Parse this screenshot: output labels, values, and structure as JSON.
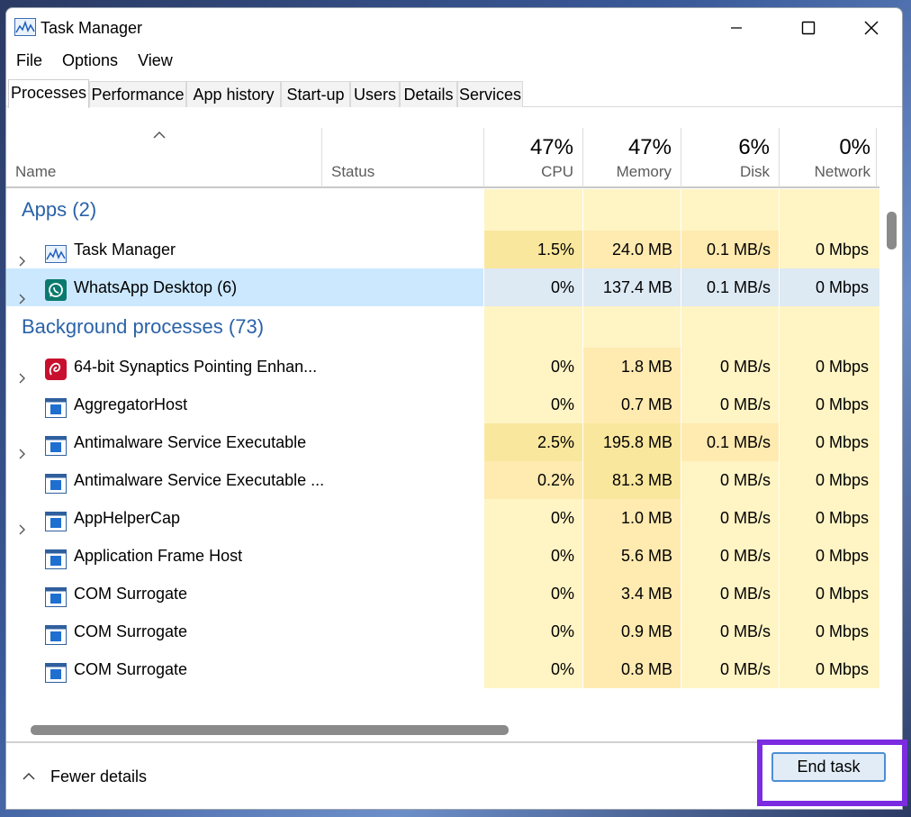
{
  "window": {
    "title": "Task Manager"
  },
  "menu": [
    "File",
    "Options",
    "View"
  ],
  "tabs": [
    "Processes",
    "Performance",
    "App history",
    "Start-up",
    "Users",
    "Details",
    "Services"
  ],
  "columns": {
    "name": "Name",
    "status": "Status",
    "cpu": {
      "pct": "47%",
      "label": "CPU"
    },
    "memory": {
      "pct": "47%",
      "label": "Memory"
    },
    "disk": {
      "pct": "6%",
      "label": "Disk"
    },
    "network": {
      "pct": "0%",
      "label": "Network"
    }
  },
  "groups": {
    "apps": "Apps (2)",
    "background": "Background processes (73)"
  },
  "apps": [
    {
      "name": "Task Manager",
      "icon": "task-manager-icon",
      "cpu": "1.5%",
      "memory": "24.0 MB",
      "disk": "0.1 MB/s",
      "network": "0 Mbps"
    },
    {
      "name": "WhatsApp Desktop (6)",
      "icon": "whatsapp-icon",
      "cpu": "0%",
      "memory": "137.4 MB",
      "disk": "0.1 MB/s",
      "network": "0 Mbps"
    }
  ],
  "background": [
    {
      "name": "64-bit Synaptics Pointing Enhan...",
      "icon": "synaptics-icon",
      "cpu": "0%",
      "memory": "1.8 MB",
      "disk": "0 MB/s",
      "network": "0 Mbps"
    },
    {
      "name": "AggregatorHost",
      "icon": "process-window-icon",
      "cpu": "0%",
      "memory": "0.7 MB",
      "disk": "0 MB/s",
      "network": "0 Mbps"
    },
    {
      "name": "Antimalware Service Executable",
      "icon": "process-window-icon",
      "cpu": "2.5%",
      "memory": "195.8 MB",
      "disk": "0.1 MB/s",
      "network": "0 Mbps"
    },
    {
      "name": "Antimalware Service Executable ...",
      "icon": "process-window-icon",
      "cpu": "0.2%",
      "memory": "81.3 MB",
      "disk": "0 MB/s",
      "network": "0 Mbps"
    },
    {
      "name": "AppHelperCap",
      "icon": "process-window-icon",
      "cpu": "0%",
      "memory": "1.0 MB",
      "disk": "0 MB/s",
      "network": "0 Mbps"
    },
    {
      "name": "Application Frame Host",
      "icon": "process-window-icon",
      "cpu": "0%",
      "memory": "5.6 MB",
      "disk": "0 MB/s",
      "network": "0 Mbps"
    },
    {
      "name": "COM Surrogate",
      "icon": "process-window-icon",
      "cpu": "0%",
      "memory": "3.4 MB",
      "disk": "0 MB/s",
      "network": "0 Mbps"
    },
    {
      "name": "COM Surrogate",
      "icon": "process-window-icon",
      "cpu": "0%",
      "memory": "0.9 MB",
      "disk": "0 MB/s",
      "network": "0 Mbps"
    },
    {
      "name": "COM Surrogate",
      "icon": "process-window-icon",
      "cpu": "0%",
      "memory": "0.8 MB",
      "disk": "0 MB/s",
      "network": "0 Mbps"
    }
  ],
  "footer": {
    "fewer_details": "Fewer details",
    "end_task": "End task"
  },
  "colors": {
    "heat_light": "#fff4c4",
    "heat_medium": "#ffeab0",
    "heat_strong": "#f9e79d",
    "group_title": "#2a62a8",
    "selection": "#cce8ff",
    "highlight_box": "#7b2be0"
  }
}
